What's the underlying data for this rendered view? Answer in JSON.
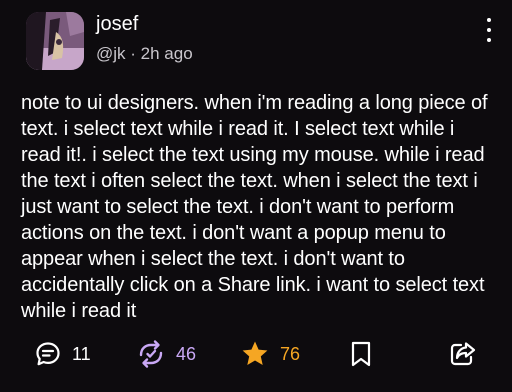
{
  "post": {
    "display_name": "josef",
    "handle": "@jk",
    "separator": " · ",
    "time": "2h ago",
    "text": "note to ui designers. when i'm reading a long piece of text. i select text while i read it. I select text while i read it!. i select the text using my mouse. while i read the text i often select the text. when i select the text i just want to select the text. i don't want to perform actions on the text. i don't want a popup menu to appear when i select the text. i don't want to accidentally click on a Share link. i want to select text while i read it"
  },
  "actions": {
    "replies": "11",
    "boosts": "46",
    "favourites": "76"
  },
  "icons": {
    "more": "more-vertical-icon",
    "reply": "reply-icon",
    "boost": "boost-icon",
    "favourite": "star-icon",
    "bookmark": "bookmark-icon",
    "share": "share-icon"
  },
  "colors": {
    "background": "#0d0b0e",
    "boost_accent": "#c9a8f5",
    "favourite_accent": "#f5a623"
  }
}
